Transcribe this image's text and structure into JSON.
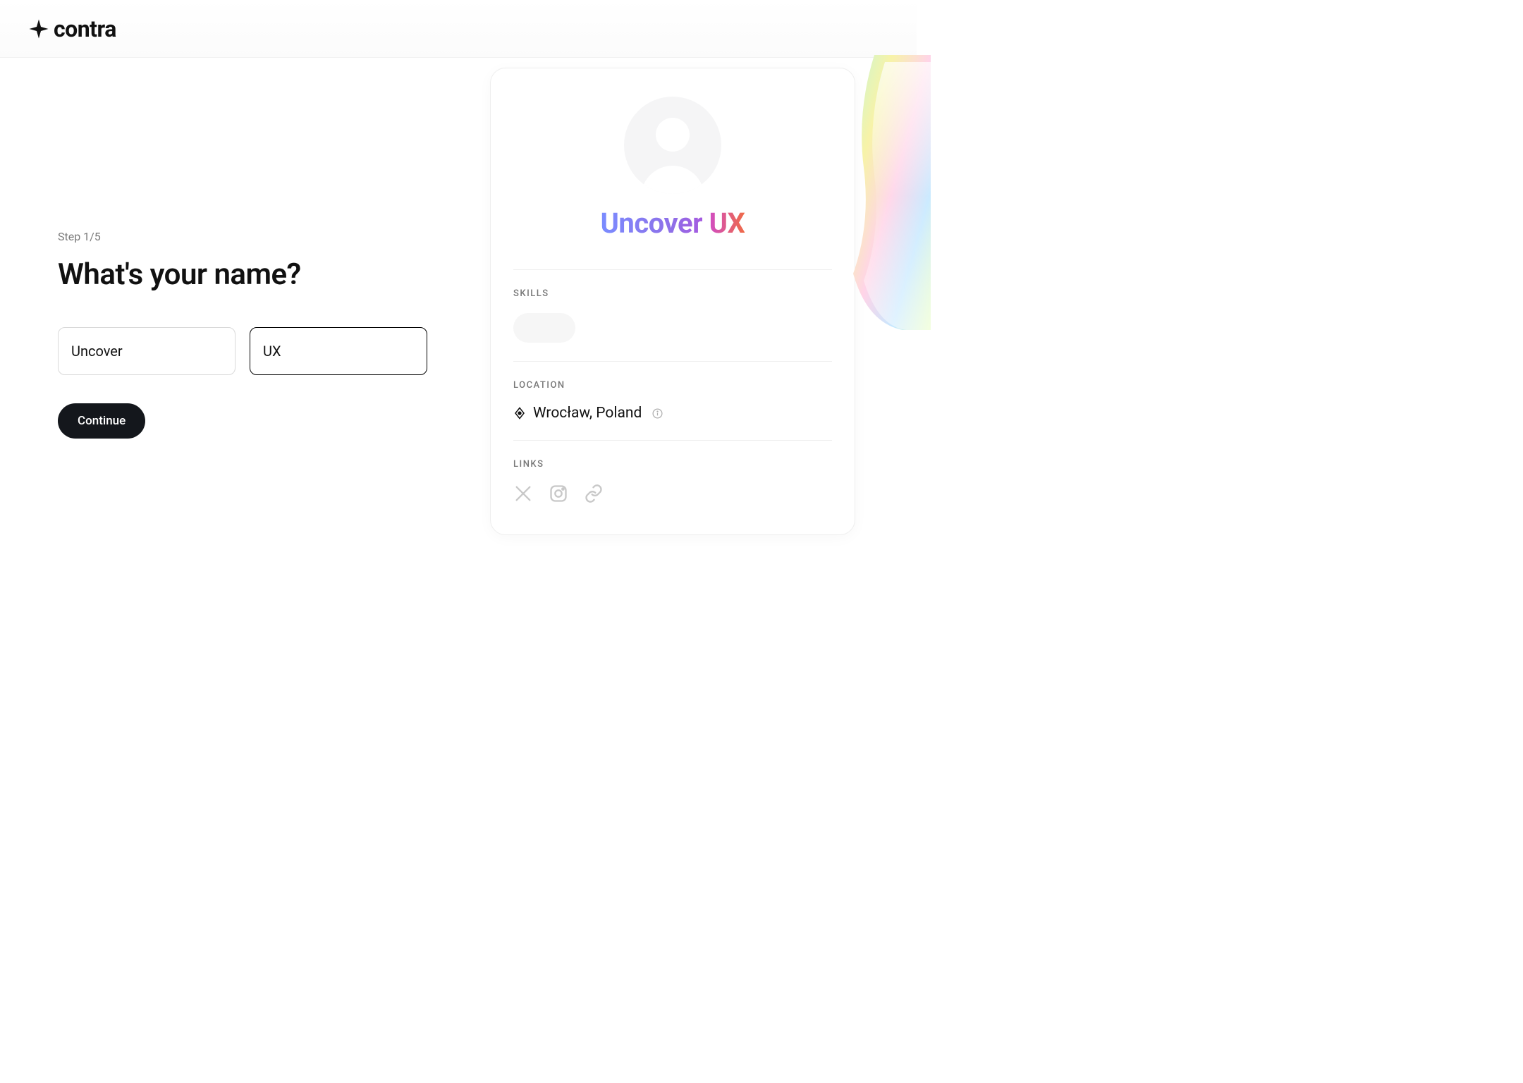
{
  "header": {
    "brand": "contra"
  },
  "form": {
    "step_label": "Step 1/5",
    "heading": "What's your name?",
    "first_name_value": "Uncover",
    "last_name_value": "UX",
    "continue_label": "Continue"
  },
  "card": {
    "display_first": "Uncover",
    "display_last": "UX",
    "skills_label": "SKILLS",
    "location_label": "LOCATION",
    "location_value": "Wrocław, Poland",
    "links_label": "LINKS"
  }
}
